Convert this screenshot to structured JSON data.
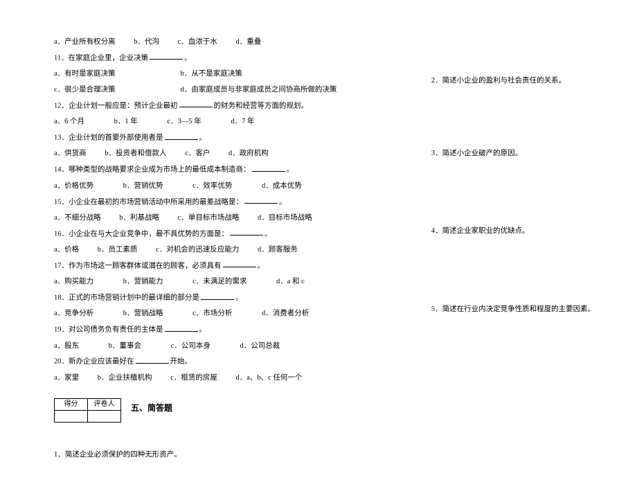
{
  "left": {
    "q10opts": [
      "a．产业所有权分离",
      "b．代沟",
      "c．血浓于水",
      "d．重叠"
    ],
    "q11": "11．在家庭企业里，企业决策",
    "q11post": "。",
    "q11a": "a．有时是家庭决策",
    "q11b": "b．从不是家庭决策",
    "q11c": "c．很少是合理决策",
    "q11d": "d．由家庭成员与非家庭成员之间协商所做的决策",
    "q12a": "12．企业计划一般应是：预计企业最初",
    "q12b": "的财务和经营等方面的规划。",
    "q12opts": [
      "a．6 个月",
      "b．1 年",
      "c．3—5 年",
      "d．7 年"
    ],
    "q13": "13．企业计划的首要外部使用者是",
    "q13post": "。",
    "q13opts": [
      "a．供货商",
      "b．投资者和借款人",
      "c．客户",
      "d．政府机构"
    ],
    "q14": "14．哪种类型的战略要求企业成为市场上的最低成本制造商：",
    "q14post": "。",
    "q14opts": [
      "a．价格优势",
      "b．营销优势",
      "c．效率优势",
      "d．成本优势"
    ],
    "q15": "15．小企业在最初的市场营销活动中所采用的最差战略是：",
    "q15post": "。",
    "q15opts": [
      "a．不细分战略",
      "b．利基战略",
      "c．单目标市场战略",
      "d．目标市场战略"
    ],
    "q16": "16．小企业在与大企业竞争中，最不具优势的方面是：",
    "q16post": "。",
    "q16opts": [
      "a．价格",
      "b．员工素质",
      "c．对机会的迅速反应能力",
      "d．顾客服务"
    ],
    "q17": "17．作为市场这一顾客群体或潜在的顾客，必须具有",
    "q17post": "。",
    "q17opts": [
      "a．购买能力",
      "b．营销能力",
      "c．未满足的需求",
      "d．a 和 c"
    ],
    "q18": "18．正式的市场营销计划中的最详细的部分是",
    "q18post": "。",
    "q18opts": [
      "a．竞争分析",
      "b．营销战略",
      "c．市场分析",
      "d．消费者分析"
    ],
    "q19": "19．对公司债务负有责任的主体是",
    "q19post": "。",
    "q19opts": [
      "a．股东",
      "b．董事会",
      "c．公司本身",
      "d．公司总裁"
    ],
    "q20": "20．新办企业应该最好在",
    "q20post": "开始。",
    "q20opts": [
      "a．家里",
      "b．企业扶植机构",
      "c．租赁的房屋",
      "d．a、b、c 任何一个"
    ],
    "score_h1": "得分",
    "score_h2": "评卷人",
    "section_title": "五、简答题",
    "sq1": "1．简述企业必须保护的四种无形资产。"
  },
  "right": {
    "sq2": "2．简述小企业的盈利与社会责任的关系。",
    "sq3": "3．简述小企业破产的原因。",
    "sq4": "4．简述企业家职业的优缺点。",
    "sq5": "5．简述在行业内决定竞争性质和程度的主要因素。"
  }
}
